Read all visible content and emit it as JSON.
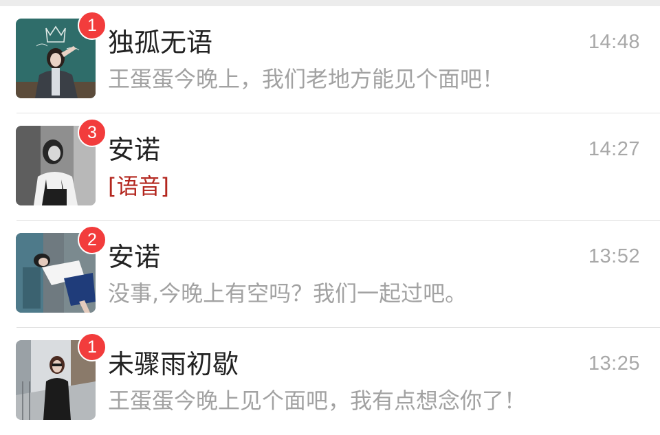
{
  "chats": [
    {
      "name": "独孤无语",
      "time": "14:48",
      "message": "王蛋蛋今晚上，我们老地方能见个面吧！",
      "unread": "1",
      "avatar": "avatar-photo-classroom"
    },
    {
      "name": "安诺",
      "time": "14:27",
      "message": "[语音]",
      "unread": "3",
      "avatar": "avatar-photo-monochrome"
    },
    {
      "name": "安诺",
      "time": "13:52",
      "message": "没事,今晚上有空吗？我们一起过吧。",
      "unread": "2",
      "avatar": "avatar-photo-street"
    },
    {
      "name": "未骤雨初歇",
      "time": "13:25",
      "message": "王蛋蛋今晚上见个面吧，我有点想念你了！",
      "unread": "1",
      "avatar": "avatar-photo-stairs"
    }
  ],
  "colors": {
    "badge": "#f23c3c",
    "voice_tag": "#b3261e",
    "time": "#a8a8a8",
    "preview": "#a2a2a2"
  }
}
